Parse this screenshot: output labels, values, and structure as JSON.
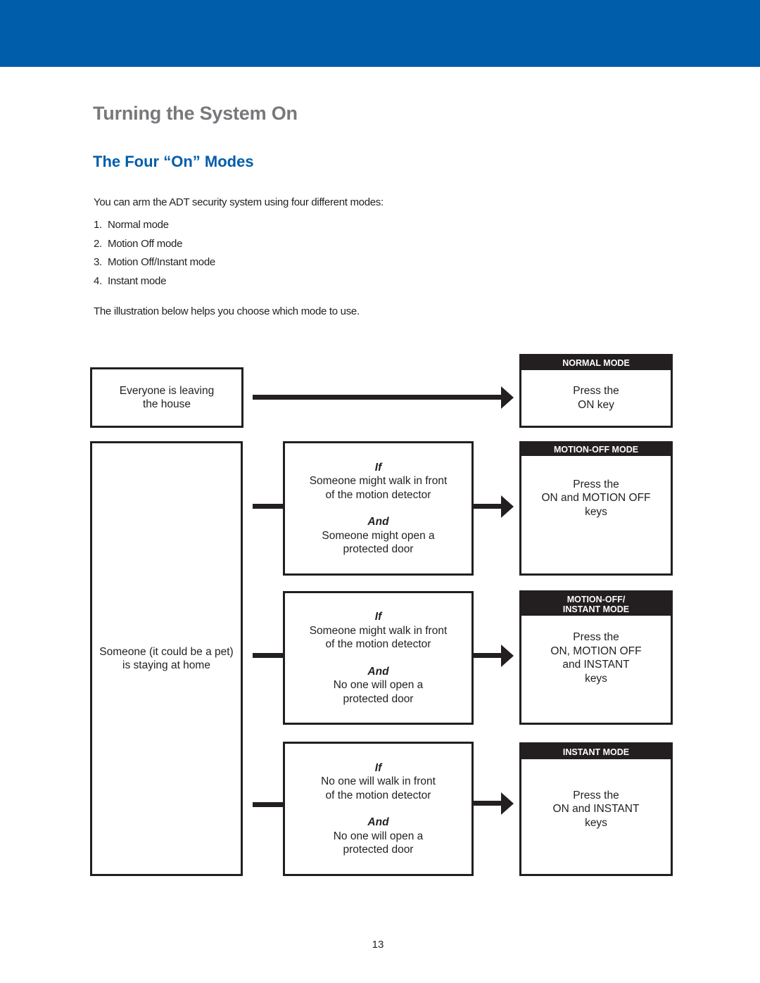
{
  "header": {
    "band_color": "#005DAA"
  },
  "page_title": "Turning the System On",
  "section_title": "The Four “On” Modes",
  "intro": "You can arm the ADT security system using four different modes:",
  "modes_list": [
    {
      "num": "1.",
      "label": "Normal mode"
    },
    {
      "num": "2.",
      "label": "Motion Off mode"
    },
    {
      "num": "3.",
      "label": "Motion Off/Instant mode"
    },
    {
      "num": "4.",
      "label": "Instant mode"
    }
  ],
  "outro": "The illustration below helps you choose which mode to use.",
  "diagram": {
    "situations": [
      {
        "lines": [
          "Everyone is leaving",
          "the house"
        ]
      },
      {
        "lines": [
          "Someone (it could be a pet)",
          "is staying at home"
        ]
      }
    ],
    "conditions": [
      {
        "if_label": "If",
        "if_lines": [
          "Someone might walk in front",
          "of the motion detector"
        ],
        "and_label": "And",
        "and_lines": [
          "Someone might open a",
          "protected door"
        ]
      },
      {
        "if_label": "If",
        "if_lines": [
          "Someone might walk in front",
          "of the motion detector"
        ],
        "and_label": "And",
        "and_lines": [
          "No one will open a",
          "protected door"
        ]
      },
      {
        "if_label": "If",
        "if_lines": [
          "No one will walk in front",
          "of the motion detector"
        ],
        "and_label": "And",
        "and_lines": [
          "No one will open a",
          "protected door"
        ]
      }
    ],
    "modes": [
      {
        "header": [
          "NORMAL MODE"
        ],
        "lines": [
          "Press the",
          "ON key"
        ]
      },
      {
        "header": [
          "MOTION-OFF MODE"
        ],
        "lines": [
          "Press the",
          "ON and MOTION OFF",
          "keys"
        ]
      },
      {
        "header": [
          "MOTION-OFF/",
          "INSTANT MODE"
        ],
        "lines": [
          "Press the",
          "ON, MOTION OFF",
          "and INSTANT",
          "keys"
        ]
      },
      {
        "header": [
          "INSTANT MODE"
        ],
        "lines": [
          "Press the",
          "ON and INSTANT",
          "keys"
        ]
      }
    ]
  },
  "page_number": "13"
}
